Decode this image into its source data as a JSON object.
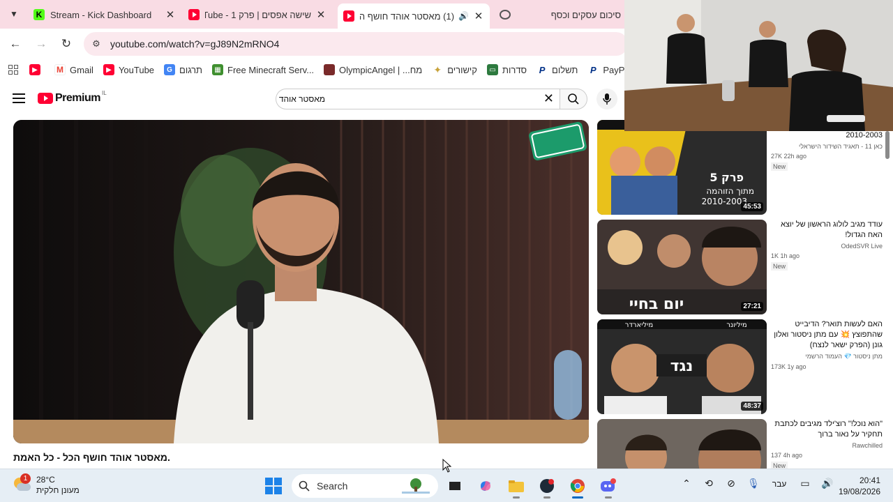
{
  "browser": {
    "tabs": [
      {
        "title": "Stream - Kick Dashboard",
        "icon": "kick-icon"
      },
      {
        "title": "שישה אפסים | פרק 1 - YouTube",
        "icon": "youtube-icon"
      },
      {
        "title": "(1) מאסטר אוהד חושף הכל",
        "icon": "youtube-icon",
        "active": true
      },
      {
        "title": "סיכום עסקים וכסף",
        "icon": "chatgpt-icon"
      }
    ],
    "url": "youtube.com/watch?v=gJ89N2mRNO4",
    "bookmarks": [
      {
        "label": "",
        "icon": "youtube-icon"
      },
      {
        "label": "Gmail",
        "icon": "gmail-icon"
      },
      {
        "label": "YouTube",
        "icon": "youtube-icon"
      },
      {
        "label": "תרגום",
        "icon": "translate-icon"
      },
      {
        "label": "Free Minecraft Serv...",
        "icon": "minecraft-icon"
      },
      {
        "label": "OlympicAngel | ...מח",
        "icon": "olympicangel-icon"
      },
      {
        "label": "קישורים",
        "icon": "spark-icon"
      },
      {
        "label": "סדרות",
        "icon": "tv-icon"
      },
      {
        "label": "תשלום",
        "icon": "paypal-icon"
      },
      {
        "label": "PayP",
        "icon": "paypal-icon"
      }
    ]
  },
  "youtube": {
    "logo_text": "Premium",
    "country": "IL",
    "search_value": "מאסטר אוהד",
    "video_title": "מאסטר אוהד חושף הכל - כל האמת.",
    "recommended": [
      {
        "title": "הישראלי | פרק 5 - מתוך הזוהמה 2010-2003",
        "channel": "כאן 11 - תאגיד השידור הישראלי",
        "stats": "27K  22h ago",
        "badge": "New",
        "duration": "45:53"
      },
      {
        "title": "עודד מגיב לולוג הראשון של יוצא האח הגדול!",
        "channel": "OdedSVR Live",
        "stats": "1K  1h ago",
        "badge": "New",
        "duration": "27:21"
      },
      {
        "title": "האם לעשות תואר? הדיבייט שהתפוצץ 💥 עם מתן ניסטור ואלון גונן (הפרק ישאר לנצח)",
        "channel": "מתן ניסטור 💎 העמוד הרשמי",
        "stats": "173K  1y ago",
        "badge": "",
        "duration": "48:37"
      },
      {
        "title": "\"הוא נוכל!\" רוצ'ילד מגיבים לכתבת תחקיר על נאור ברוך",
        "channel": "Rawchilled",
        "stats": "137  4h ago",
        "badge": "New",
        "duration": ""
      }
    ],
    "thumb_texts": [
      "פרק 5",
      "מתוך הזוהמה",
      "2010-2003",
      "יום בחיי",
      "נגד",
      "מיליארדר",
      "מיליונר",
      "כאן 11"
    ]
  },
  "taskbar": {
    "badge": "1",
    "temperature": "28°C",
    "weather": "מעונן חלקית",
    "search_label": "Search",
    "language": "עבר",
    "time": "20:41",
    "date": "19/08/2026"
  }
}
